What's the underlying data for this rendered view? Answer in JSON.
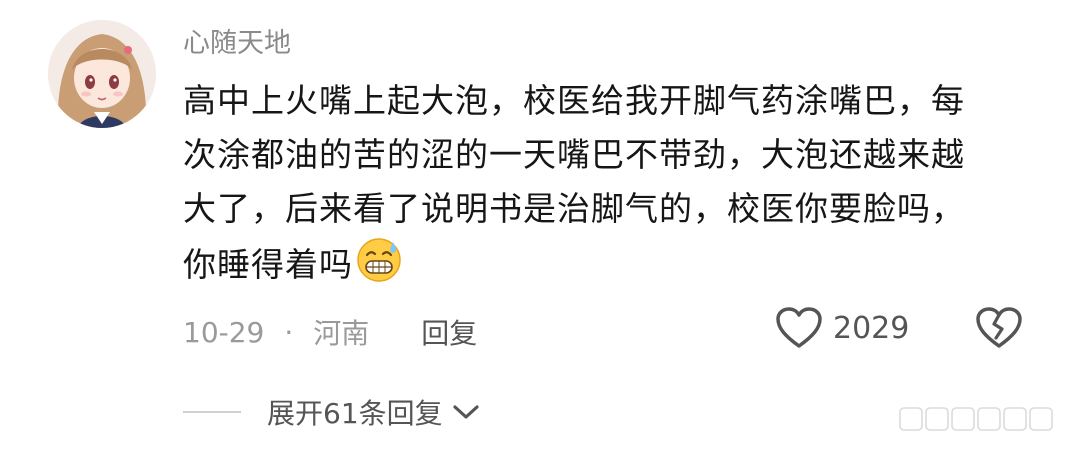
{
  "comment": {
    "username": "心随天地",
    "body_lines": [
      "高中上火嘴上起大泡，校医给我开脚气药涂嘴巴，每",
      "次涂都油的苦的涩的一天嘴巴不带劲，大泡还越来越",
      "大了，后来看了说明书是治脚气的，校医你要脸吗，",
      "你睡得着吗"
    ],
    "emoji": "grinning-sweat-emoji",
    "date": "10-29",
    "separator": "·",
    "location": "河南",
    "reply_label": "回复",
    "like_count": "2029",
    "expand_label": "展开61条回复"
  },
  "colors": {
    "username": "#8a8a8a",
    "text": "#161616",
    "meta": "#9a9a9a",
    "icon": "#555555"
  },
  "icons": {
    "like": "heart-outline-icon",
    "dislike": "broken-heart-icon",
    "expand": "chevron-down-icon"
  }
}
